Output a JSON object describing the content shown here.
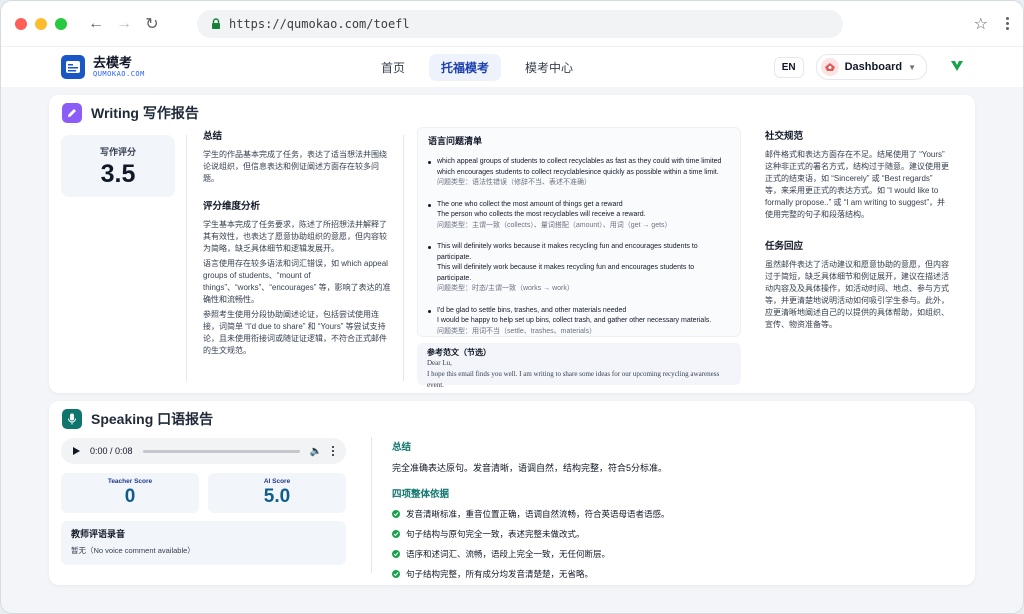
{
  "browser": {
    "url": "https://qumokao.com/toefl"
  },
  "header": {
    "logo_cn": "去模考",
    "logo_en": "QUMOKAO.COM",
    "nav": [
      {
        "label": "首页"
      },
      {
        "label": "托福模考",
        "active": true
      },
      {
        "label": "模考中心"
      }
    ],
    "lang": "EN",
    "dashboard": "Dashboard"
  },
  "writing": {
    "title": "Writing  写作报告",
    "score_label": "写作评分",
    "score_value": "3.5",
    "summary_title": "总结",
    "summary_text": "学生的作品基本完成了任务，表达了适当想法并围绕论说组织，但信息表达和例证阐述方面存在较多问题。",
    "dim_title": "评分维度分析",
    "dim_p1": "学生基本完成了任务要求，陈述了所招想法并解释了其有效性，也表达了愿意协助组织的意愿，但内容较为简略，缺乏具体细节和逻辑发展开。",
    "dim_p2": "语言使用存在较多语法和词汇错误，如 which appeal groups of students、“mount of things”、“works”、“encourages” 等，影响了表达的准确性和流畅性。",
    "dim_p3": "参照考生使用分段协助阐述论证，包括尝试使用连接，词简单 “I'd due to share” 和 “Yours” 等尝试支持论，且未使用衔接词或随证证逻辑，不符合正式邮件的生文规范。",
    "issues_title": "语言问题清单",
    "issues": [
      {
        "orig": "which appeal groups of students to collect recyclables as fast as they could with time limited",
        "fix": "which encourages students to collect recyclablesince quickly as possible within a time limit.",
        "type": "问题类型：语法性错误（修辞不当、表述不准确）"
      },
      {
        "orig": "The one who collect the most amount of things get a reward",
        "fix": "The person who collects the most recyclables will receive a reward.",
        "type": "问题类型：主谓一致（collects）、量词搭配（amount）、用词（get → gets）"
      },
      {
        "orig": "This will definitely works because it makes recycling fun and encourages students to participate.",
        "fix": "This will definitely work because it makes recycling fun and encourages students to participate.",
        "type": "问题类型：时态/主谓一致（works → work）"
      },
      {
        "orig": "I'd be glad to settle bins, trashes, and other materials needed",
        "fix": "I would be happy to help set up bins, collect trash, and gather other necessary materials.",
        "type": "问题类型：用词不当（settle、trashes、materials）"
      }
    ],
    "sample_title": "参考范文（节选）",
    "sample_l1": "Dear Lu,",
    "sample_l2": "I hope this email finds you well. I am writing to share some ideas for our upcoming recycling awareness event.",
    "social_title": "社交规范",
    "social_text": "邮件格式和表达方面存在不足。结尾使用了 “Yours” 这种非正式的署名方式，结构过于随意。建议使用更正式的结束语，如 “Sincerely” 或 “Best regards” 等，来采用更正式的表达方式。如 “I would like to formally propose..” 或 “I am writing to suggest”，并使用完整的句子和段落结构。",
    "task_title": "任务回应",
    "task_text": "虽然邮件表达了活动建议和愿意协助的意愿，但内容过于简短，缺乏具体细节和例证展开，建议在描述活动内容及及具体操作，如活动时间、地点、参与方式等，并更清楚地说明活动如何吸引学生参与。此外，应更清晰地阐述自己的以提供的具体帮助，如组织、宣传、物资准备等。"
  },
  "speaking": {
    "title": "Speaking  口语报告",
    "audio_time": "0:00 / 0:08",
    "teacher_label": "Teacher Score",
    "teacher_value": "0",
    "ai_label": "AI Score",
    "ai_value": "5.0",
    "rec_title": "教师评语录音",
    "rec_text": "暂无（No voice comment available）",
    "summary_title": "总结",
    "summary_text": "完全准确表达原句。发音清晰，语调自然，结构完整，符合5分标准。",
    "basis_title": "四项整体依据",
    "basis": [
      "发音清晰标准，重音位置正确，语调自然流畅，符合英语母语者语感。",
      "句子结构与原句完全一致，表述完整未做改式。",
      "语序和述词汇、流畅，语段上完全一致，无任何断层。",
      "句子结构完整，所有成分均发音清楚楚，无省略。"
    ]
  }
}
